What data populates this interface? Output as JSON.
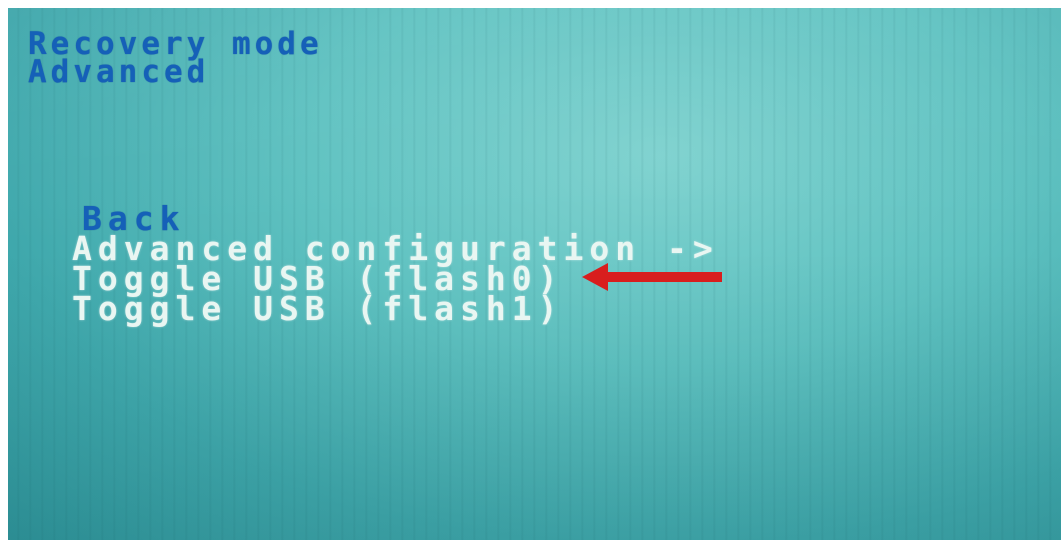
{
  "header": {
    "line1": "Recovery mode",
    "line2": "Advanced"
  },
  "menu": {
    "items": [
      {
        "label": "Back"
      },
      {
        "label": "Advanced configuration ->"
      },
      {
        "label": "Toggle USB (flash0)"
      },
      {
        "label": "Toggle USB (flash1)"
      }
    ]
  },
  "annotation": {
    "arrow_color": "#d81e1e",
    "arrow_target": "Toggle USB (flash0)"
  },
  "colors": {
    "screen_bg": "#5fc2c1",
    "header_text": "#1560b8",
    "menu_text": "#e9f6f2"
  }
}
